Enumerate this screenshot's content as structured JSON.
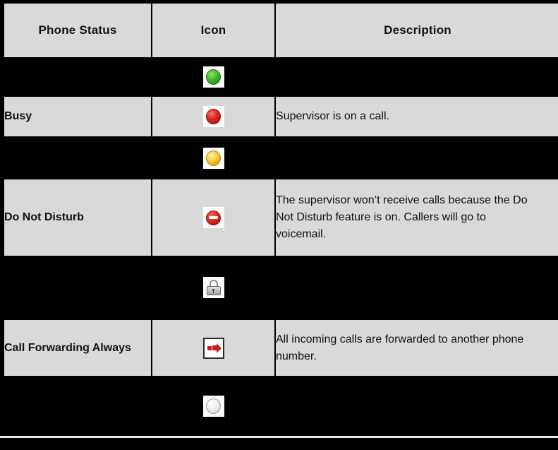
{
  "table": {
    "columns": [
      {
        "key": "status",
        "label": "Phone Status"
      },
      {
        "key": "icon",
        "label": "Icon"
      },
      {
        "key": "description",
        "label": "Description"
      }
    ],
    "rows": [
      {
        "status": "",
        "icon_name": "green-circle-icon",
        "description": "",
        "row_style": "dark"
      },
      {
        "status": "Busy",
        "icon_name": "red-circle-icon",
        "description": "Supervisor is on a call.",
        "row_style": "light"
      },
      {
        "status": "",
        "icon_name": "yellow-circle-icon",
        "description": "",
        "row_style": "dark"
      },
      {
        "status": "Do Not Disturb",
        "icon_name": "do-not-disturb-icon",
        "description": "The supervisor won’t receive calls because the Do Not Disturb feature is on. Callers will go to voicemail.",
        "row_style": "light"
      },
      {
        "status": "",
        "icon_name": "padlock-icon",
        "description": "",
        "row_style": "dark"
      },
      {
        "status": "Call Forwarding Always",
        "icon_name": "call-forward-arrow-icon",
        "description": "All incoming calls are forwarded to another phone number.",
        "row_style": "light"
      },
      {
        "status": "",
        "icon_name": "white-circle-icon",
        "description": "",
        "row_style": "dark"
      }
    ]
  },
  "colors": {
    "header_background": "#d9d9d9",
    "row_light_background": "#d9d9d9",
    "row_dark_background": "#000000",
    "grid_line": "#000000",
    "page_background": "#000000",
    "text": "#111111",
    "icon_green": "#4cbb32",
    "icon_red": "#de2a20",
    "icon_yellow": "#f6ce46",
    "icon_white": "#f2f2f2",
    "icon_lock_grey": "#bdbdbd",
    "icon_arrow_red": "#cc1f1f"
  }
}
